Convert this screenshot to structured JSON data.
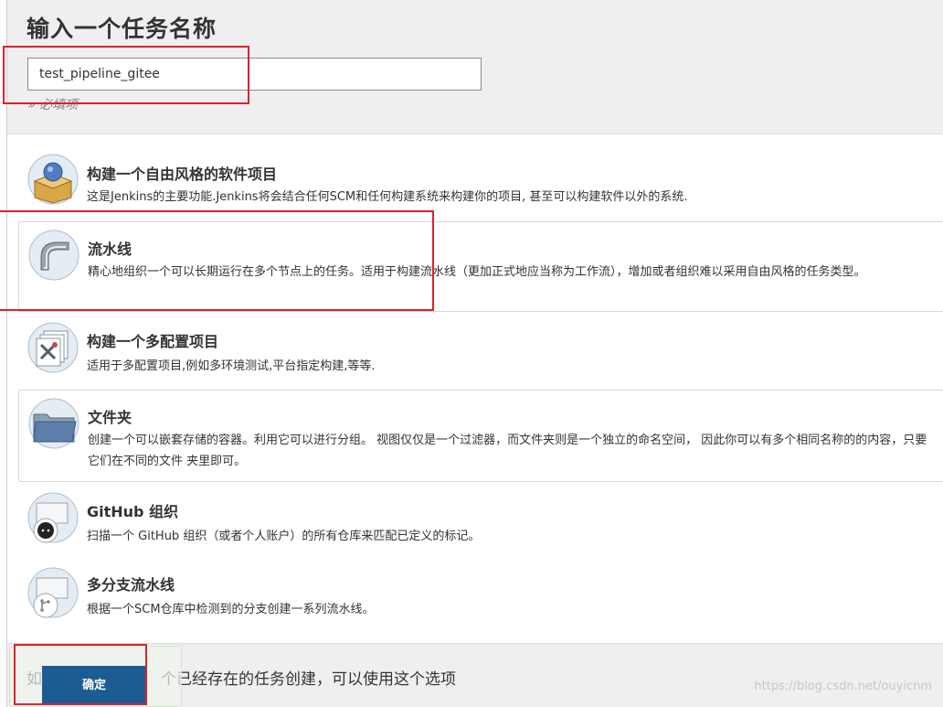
{
  "page": {
    "title": "输入一个任务名称",
    "name_input_value": "test_pipeline_gitee",
    "required_hint": "» 必填项"
  },
  "items": [
    {
      "name": "构建一个自由风格的软件项目",
      "desc": "这是Jenkins的主要功能.Jenkins将会结合任何SCM和任何构建系统来构建你的项目, 甚至可以构建软件以外的系统.",
      "icon": "freestyle-box-icon"
    },
    {
      "name": "流水线",
      "desc": "精心地组织一个可以长期运行在多个节点上的任务。适用于构建流水线（更加正式地应当称为工作流），增加或者组织难以采用自由风格的任务类型。",
      "icon": "pipeline-icon"
    },
    {
      "name": "构建一个多配置项目",
      "desc": "适用于多配置项目,例如多环境测试,平台指定构建,等等.",
      "icon": "multi-config-icon"
    },
    {
      "name": "文件夹",
      "desc": "创建一个可以嵌套存储的容器。利用它可以进行分组。 视图仅仅是一个过滤器，而文件夹则是一个独立的命名空间， 因此你可以有多个相同名称的的内容，只要它们在不同的文件 夹里即可。",
      "icon": "folder-icon"
    },
    {
      "name": "GitHub 组织",
      "desc": "扫描一个 GitHub 组织（或者个人账户）的所有仓库来匹配已定义的标记。",
      "icon": "github-org-icon"
    },
    {
      "name": "多分支流水线",
      "desc": "根据一个SCM仓库中检测到的分支创建一系列流水线。",
      "icon": "multibranch-icon"
    }
  ],
  "footer": {
    "copy_hint_visible": "如",
    "copy_hint_rest": "个已经存在的任务创建，可以使用这个选项",
    "ok_label": "确定"
  },
  "watermark": "https://blog.csdn.net/ouyicnm",
  "colors": {
    "header_bg": "#efefef",
    "ok_button": "#1c5c94",
    "highlight_red": "#d9232f"
  }
}
